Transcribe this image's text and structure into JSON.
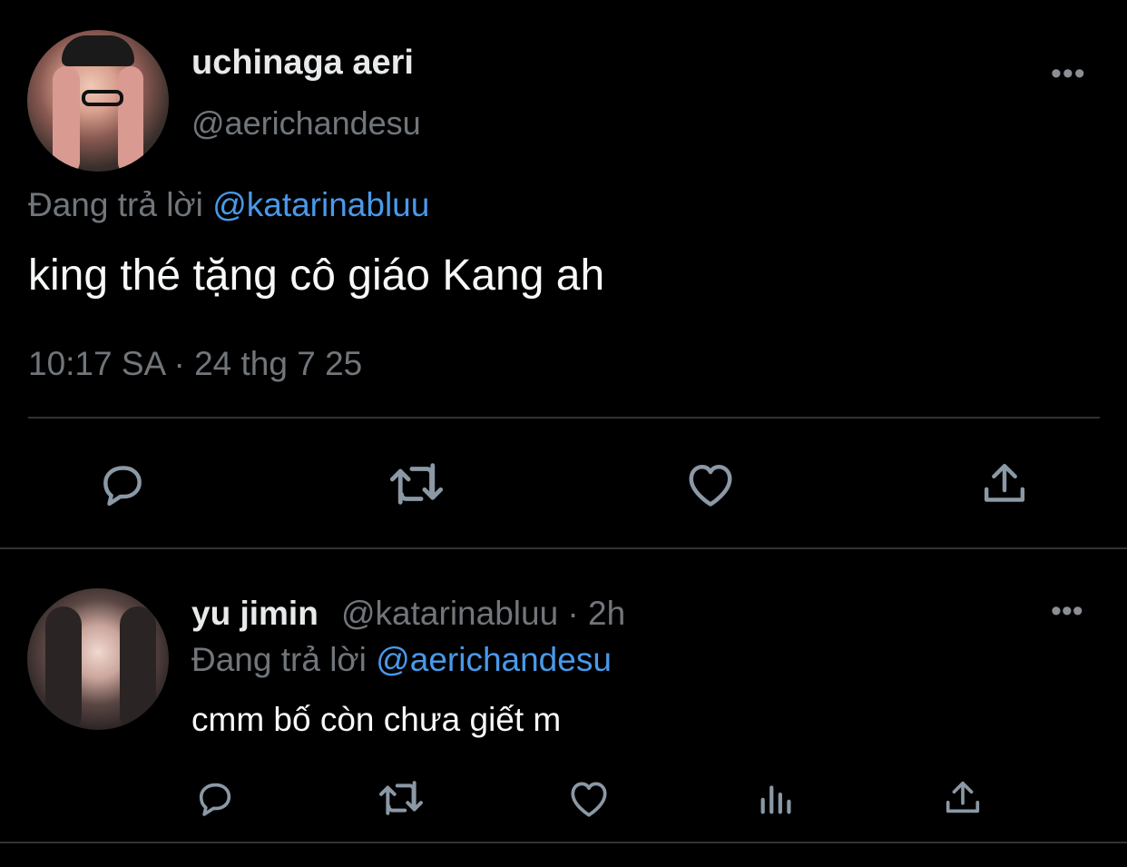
{
  "main_tweet": {
    "author_name": "uchinaga aeri",
    "author_handle": "@aerichandesu",
    "more_label": "•••",
    "replying_prefix": "Đang trả lời",
    "replying_to": "@katarinabluu",
    "text": "king thé tặng cô giáo Kang ah",
    "timestamp": "10:17 SA · 24 thg 7 25",
    "actions": [
      "reply-icon",
      "retweet-icon",
      "like-icon",
      "share-icon"
    ]
  },
  "reply_tweet": {
    "author_name": "yu jimin",
    "author_handle_time": "@katarinabluu · 2h",
    "more_label": "•••",
    "replying_prefix": "Đang trả lời",
    "replying_to": "@aerichandesu",
    "text": "cmm bố còn chưa giết m",
    "actions": [
      "reply-icon",
      "retweet-icon",
      "like-icon",
      "views-icon",
      "share-icon"
    ]
  },
  "colors": {
    "background": "#000000",
    "text_primary": "#e7e9ea",
    "text_secondary": "#71767b",
    "link": "#4a99e9",
    "divider": "#2f3336",
    "icon": "#8b98a5"
  }
}
